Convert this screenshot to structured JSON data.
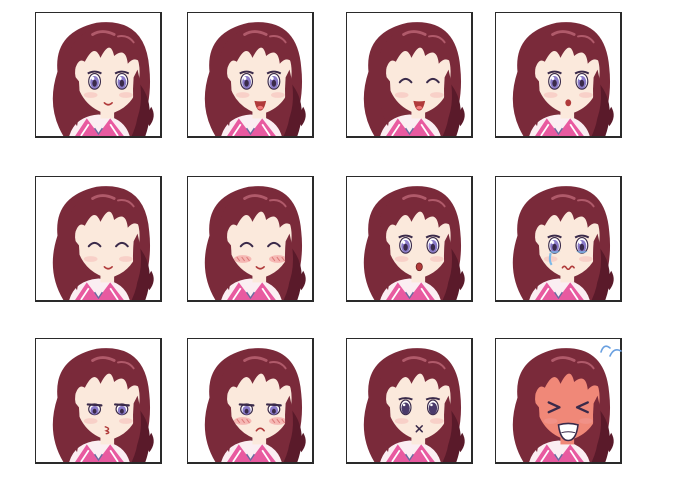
{
  "sheet": {
    "title": "",
    "colors": {
      "background": "#ffffff",
      "frame": "#2a2a2a",
      "hair": "#7a2a3a",
      "hair_shade": "#5a1a2a",
      "hair_highlight": "#b05a6a",
      "skin": "#fbe9dc",
      "blush": "#f4a2a2",
      "eye_iris": "#8a7ac8",
      "eye_dark": "#3a2a4a",
      "mouth": "#b03a3a",
      "sailor_collar": "#e85aa0",
      "collar_stripe": "#ffffff",
      "blouse": "#fbeef2",
      "tears": "#7ab8e8",
      "embarrassed_face": "#f08878",
      "sweat_mark": "#6aa0e0"
    },
    "expressions": [
      {
        "id": "smile",
        "eyes": "open",
        "mouth": "smile",
        "blush": false,
        "tears": false,
        "face": "normal"
      },
      {
        "id": "happy-open-mouth",
        "eyes": "open",
        "mouth": "open-smile",
        "blush": false,
        "tears": false,
        "face": "normal"
      },
      {
        "id": "laugh-eyes-closed",
        "eyes": "closed-happy",
        "mouth": "open-smile",
        "blush": false,
        "tears": false,
        "face": "normal"
      },
      {
        "id": "surprised-small",
        "eyes": "open",
        "mouth": "small-open",
        "blush": false,
        "tears": false,
        "face": "normal"
      },
      {
        "id": "wink",
        "eyes": "wink",
        "mouth": "smile",
        "blush": false,
        "tears": false,
        "face": "normal"
      },
      {
        "id": "content-blush",
        "eyes": "closed-happy",
        "mouth": "smile",
        "blush": true,
        "tears": false,
        "face": "normal"
      },
      {
        "id": "oh",
        "eyes": "open",
        "mouth": "o",
        "blush": false,
        "tears": false,
        "face": "normal"
      },
      {
        "id": "teary",
        "eyes": "teary",
        "mouth": "wobbly",
        "blush": false,
        "tears": true,
        "face": "normal"
      },
      {
        "id": "pout",
        "eyes": "half",
        "mouth": "pout",
        "blush": false,
        "tears": false,
        "face": "normal"
      },
      {
        "id": "annoyed-blush",
        "eyes": "half",
        "mouth": "frown",
        "blush": true,
        "tears": false,
        "face": "normal"
      },
      {
        "id": "blank-x-mouth",
        "eyes": "dark",
        "mouth": "x",
        "blush": false,
        "tears": false,
        "face": "normal"
      },
      {
        "id": "embarrassed-shout",
        "eyes": "squeezed",
        "mouth": "wide-open",
        "blush": false,
        "tears": false,
        "face": "red"
      }
    ]
  }
}
